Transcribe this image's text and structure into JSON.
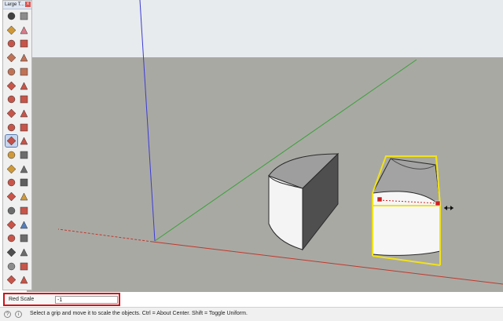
{
  "toolbar": {
    "title": "Large T...",
    "close_glyph": "x",
    "active_tool": "scale-tool",
    "tools": [
      {
        "name": "select-tool-icon",
        "color": "#222222"
      },
      {
        "name": "component-tool-icon",
        "color": "#7a7a7a"
      },
      {
        "name": "paint-bucket-icon",
        "color": "#c98a1a"
      },
      {
        "name": "eraser-icon",
        "color": "#d36a7a"
      },
      {
        "name": "line-tool-icon",
        "color": "#c0392b"
      },
      {
        "name": "freehand-tool-icon",
        "color": "#c0392b"
      },
      {
        "name": "rectangle-tool-icon",
        "color": "#b85c3a"
      },
      {
        "name": "rotated-rectangle-icon",
        "color": "#b85c3a"
      },
      {
        "name": "circle-tool-icon",
        "color": "#b85c3a"
      },
      {
        "name": "polygon-tool-icon",
        "color": "#b85c3a"
      },
      {
        "name": "arc-tool-icon",
        "color": "#c0392b"
      },
      {
        "name": "pie-tool-icon",
        "color": "#c0392b"
      },
      {
        "name": "three-point-arc-icon",
        "color": "#c0392b"
      },
      {
        "name": "two-point-arc-icon",
        "color": "#c0392b"
      },
      {
        "name": "move-tool-icon",
        "color": "#c0392b"
      },
      {
        "name": "push-pull-icon",
        "color": "#c0392b"
      },
      {
        "name": "rotate-tool-icon",
        "color": "#c0392b"
      },
      {
        "name": "follow-me-icon",
        "color": "#c0392b"
      },
      {
        "name": "scale-tool-icon",
        "color": "#c0392b"
      },
      {
        "name": "offset-tool-icon",
        "color": "#c0392b"
      },
      {
        "name": "tape-measure-icon",
        "color": "#c98a1a"
      },
      {
        "name": "dimension-tool-icon",
        "color": "#555555"
      },
      {
        "name": "protractor-icon",
        "color": "#c98a1a"
      },
      {
        "name": "text-tool-icon",
        "color": "#555555"
      },
      {
        "name": "axes-tool-icon",
        "color": "#c0392b"
      },
      {
        "name": "3d-text-icon",
        "color": "#444444"
      },
      {
        "name": "orbit-tool-icon",
        "color": "#c0392b"
      },
      {
        "name": "pan-tool-icon",
        "color": "#c98a1a"
      },
      {
        "name": "zoom-tool-icon",
        "color": "#555555"
      },
      {
        "name": "zoom-window-icon",
        "color": "#c0392b"
      },
      {
        "name": "zoom-extents-icon",
        "color": "#c0392b"
      },
      {
        "name": "previous-view-icon",
        "color": "#3a6ab0"
      },
      {
        "name": "position-camera-icon",
        "color": "#c0392b"
      },
      {
        "name": "look-around-icon",
        "color": "#555555"
      },
      {
        "name": "walk-tool-icon",
        "color": "#333333"
      },
      {
        "name": "section-plane-icon",
        "color": "#555555"
      },
      {
        "name": "warehouse-icon",
        "color": "#7a7a7a"
      },
      {
        "name": "extension-warehouse-icon",
        "color": "#c0392b"
      },
      {
        "name": "share-model-icon",
        "color": "#c0392b"
      },
      {
        "name": "extension-manager-icon",
        "color": "#c0392b"
      }
    ]
  },
  "measurements": {
    "label": "Red Scale",
    "value": "-1"
  },
  "status": {
    "text": "Select a grip and move it to scale the objects. Ctrl = About Center. Shift = Toggle Uniform."
  },
  "colors": {
    "sky": "#e8ebee",
    "ground": "#a9a9a4",
    "red_axis": "#c0392b",
    "green_axis": "#3aa13a",
    "blue_axis": "#3b3bd6",
    "selection": "#f1e21a",
    "grip": "#cc2020"
  }
}
